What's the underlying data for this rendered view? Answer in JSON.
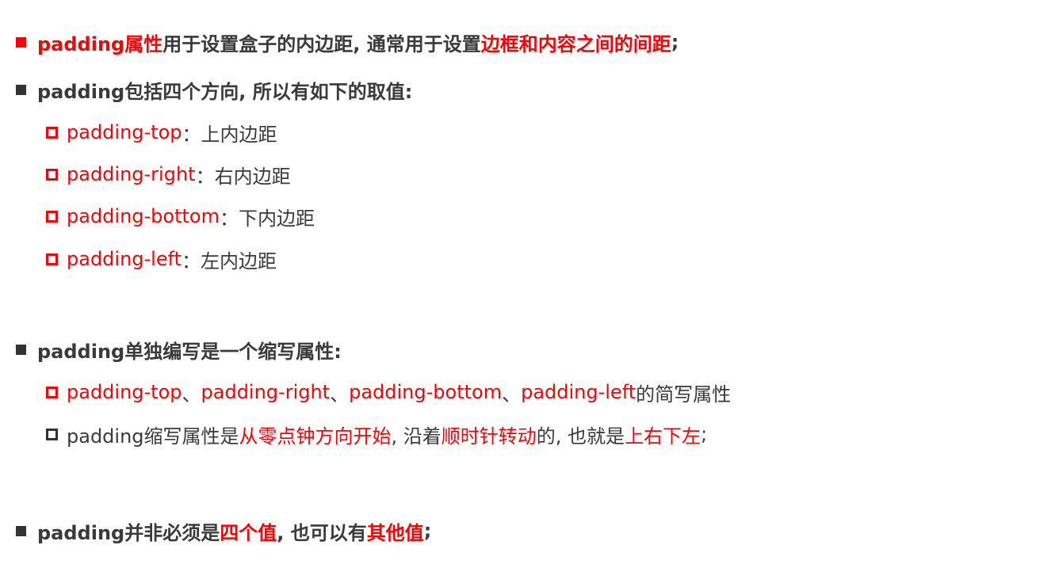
{
  "colors": {
    "accent": "#ff0000",
    "text": "#3a3a3a",
    "bullet_dark": "#333333"
  },
  "items": [
    {
      "bullet": "solid-square",
      "bullet_color": "#ff0000",
      "segments": [
        {
          "text": "padding属性",
          "color": "#ff0000"
        },
        {
          "text": "用于设置盒子的内边距, 通常用于设置",
          "color": "#3a3a3a"
        },
        {
          "text": "边框和内容之间的间距",
          "color": "#ff0000"
        },
        {
          "text": ";",
          "color": "#3a3a3a"
        }
      ]
    },
    {
      "bullet": "solid-square",
      "bullet_color": "#333333",
      "segments": [
        {
          "text": "padding包括四个方向, 所以有如下的取值:",
          "color": "#3a3a3a"
        }
      ]
    },
    {
      "bullet": "hollow-square",
      "bullet_color": "#ff0000",
      "segments": [
        {
          "text": "padding-top",
          "color": "#ff0000"
        },
        {
          "text": "：上内边距",
          "color": "#3a3a3a"
        }
      ]
    },
    {
      "bullet": "hollow-square",
      "bullet_color": "#ff0000",
      "segments": [
        {
          "text": "padding-right",
          "color": "#ff0000"
        },
        {
          "text": "：右内边距",
          "color": "#3a3a3a"
        }
      ]
    },
    {
      "bullet": "hollow-square",
      "bullet_color": "#ff0000",
      "segments": [
        {
          "text": "padding-bottom",
          "color": "#ff0000"
        },
        {
          "text": "：下内边距",
          "color": "#3a3a3a"
        }
      ]
    },
    {
      "bullet": "hollow-square",
      "bullet_color": "#ff0000",
      "segments": [
        {
          "text": "padding-left",
          "color": "#ff0000"
        },
        {
          "text": "：左内边距",
          "color": "#3a3a3a"
        }
      ]
    },
    {
      "bullet": "solid-square",
      "bullet_color": "#333333",
      "segments": [
        {
          "text": "padding单独编写是一个缩写属性:",
          "color": "#3a3a3a"
        }
      ]
    },
    {
      "bullet": "hollow-square",
      "bullet_color": "#ff0000",
      "segments": [
        {
          "text": "padding-top",
          "color": "#ff0000"
        },
        {
          "text": "、",
          "color": "#3a3a3a"
        },
        {
          "text": "padding-right",
          "color": "#ff0000"
        },
        {
          "text": "、",
          "color": "#3a3a3a"
        },
        {
          "text": "padding-bottom",
          "color": "#ff0000"
        },
        {
          "text": "、",
          "color": "#3a3a3a"
        },
        {
          "text": "padding-left",
          "color": "#ff0000"
        },
        {
          "text": "的简写属性",
          "color": "#3a3a3a"
        }
      ]
    },
    {
      "bullet": "hollow-square",
      "bullet_color": "#333333",
      "segments": [
        {
          "text": "padding缩写属性是",
          "color": "#3a3a3a"
        },
        {
          "text": "从零点钟方向开始",
          "color": "#ff0000"
        },
        {
          "text": ", 沿着",
          "color": "#3a3a3a"
        },
        {
          "text": "顺时针转动",
          "color": "#ff0000"
        },
        {
          "text": "的, 也就是",
          "color": "#3a3a3a"
        },
        {
          "text": "上右下左",
          "color": "#ff0000"
        },
        {
          "text": ";",
          "color": "#3a3a3a"
        }
      ]
    },
    {
      "bullet": "solid-square",
      "bullet_color": "#333333",
      "segments": [
        {
          "text": "padding并非必须是",
          "color": "#3a3a3a"
        },
        {
          "text": "四个值",
          "color": "#ff0000"
        },
        {
          "text": ", 也可以有",
          "color": "#3a3a3a"
        },
        {
          "text": "其他值",
          "color": "#ff0000"
        },
        {
          "text": ";",
          "color": "#3a3a3a"
        }
      ]
    }
  ]
}
